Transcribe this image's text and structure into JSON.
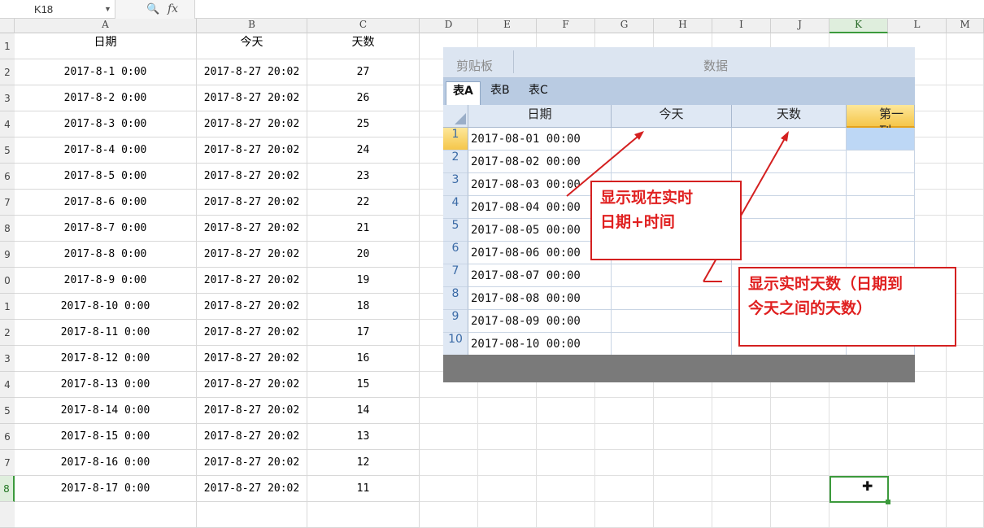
{
  "formula_bar": {
    "name_box": "K18",
    "fx_label": "fx"
  },
  "columns": [
    "A",
    "B",
    "C",
    "D",
    "E",
    "F",
    "G",
    "H",
    "I",
    "J",
    "K",
    "L",
    "M"
  ],
  "sheet": {
    "headers": [
      "日期",
      "今天",
      "天数"
    ],
    "row_numbers": [
      "1",
      "2",
      "3",
      "4",
      "5",
      "6",
      "7",
      "8",
      "9",
      "0",
      "1",
      "2",
      "3",
      "4",
      "5",
      "6",
      "7",
      "8"
    ],
    "rows": [
      [
        "2017-8-1 0:00",
        "2017-8-27 20:02",
        "27"
      ],
      [
        "2017-8-2 0:00",
        "2017-8-27 20:02",
        "26"
      ],
      [
        "2017-8-3 0:00",
        "2017-8-27 20:02",
        "25"
      ],
      [
        "2017-8-4 0:00",
        "2017-8-27 20:02",
        "24"
      ],
      [
        "2017-8-5 0:00",
        "2017-8-27 20:02",
        "23"
      ],
      [
        "2017-8-6 0:00",
        "2017-8-27 20:02",
        "22"
      ],
      [
        "2017-8-7 0:00",
        "2017-8-27 20:02",
        "21"
      ],
      [
        "2017-8-8 0:00",
        "2017-8-27 20:02",
        "20"
      ],
      [
        "2017-8-9 0:00",
        "2017-8-27 20:02",
        "19"
      ],
      [
        "2017-8-10 0:00",
        "2017-8-27 20:02",
        "18"
      ],
      [
        "2017-8-11 0:00",
        "2017-8-27 20:02",
        "17"
      ],
      [
        "2017-8-12 0:00",
        "2017-8-27 20:02",
        "16"
      ],
      [
        "2017-8-13 0:00",
        "2017-8-27 20:02",
        "15"
      ],
      [
        "2017-8-14 0:00",
        "2017-8-27 20:02",
        "14"
      ],
      [
        "2017-8-15 0:00",
        "2017-8-27 20:02",
        "13"
      ],
      [
        "2017-8-16 0:00",
        "2017-8-27 20:02",
        "12"
      ],
      [
        "2017-8-17 0:00",
        "2017-8-27 20:02",
        "11"
      ]
    ]
  },
  "app": {
    "ribbon": {
      "clipboard": "剪贴板",
      "data": "数据"
    },
    "tabs": [
      "表A",
      "表B",
      "表C"
    ],
    "headers": [
      "日期",
      "今天",
      "天数",
      "第一列"
    ],
    "rows": [
      [
        "1",
        "2017-08-01 00:00"
      ],
      [
        "2",
        "2017-08-02 00:00"
      ],
      [
        "3",
        "2017-08-03 00:00"
      ],
      [
        "4",
        "2017-08-04 00:00"
      ],
      [
        "5",
        "2017-08-05 00:00"
      ],
      [
        "6",
        "2017-08-06 00:00"
      ],
      [
        "7",
        "2017-08-07 00:00"
      ],
      [
        "8",
        "2017-08-08 00:00"
      ],
      [
        "9",
        "2017-08-09 00:00"
      ],
      [
        "10",
        "2017-08-10 00:00"
      ]
    ]
  },
  "annotations": {
    "note1": [
      "显示现在实时",
      "日期+时间"
    ],
    "note2": [
      "显示实时天数（日期到",
      "今天之间的天数）"
    ],
    "color": "#d42020"
  }
}
